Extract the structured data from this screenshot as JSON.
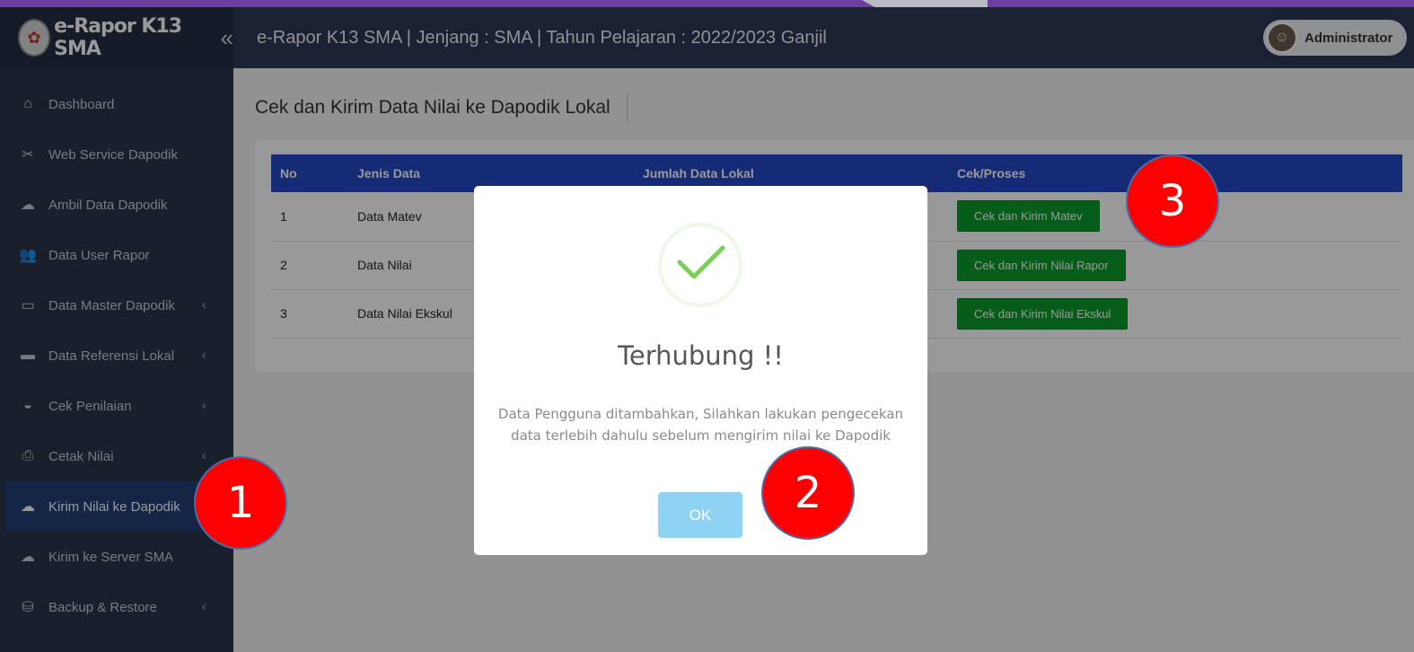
{
  "app": {
    "brand": "e-Rapor K13 SMA",
    "header_title": "e-Rapor K13 SMA | Jenjang : SMA | Tahun Pelajaran : 2022/2023 Ganjil",
    "user_name": "Administrator"
  },
  "sidebar": {
    "collapse_icon": "double-chevron-left-icon",
    "items": [
      {
        "label": "Dashboard",
        "icon": "home-icon",
        "has_caret": false
      },
      {
        "label": "Web Service Dapodik",
        "icon": "tools-icon",
        "has_caret": false
      },
      {
        "label": "Ambil Data Dapodik",
        "icon": "cloud-download-icon",
        "has_caret": false
      },
      {
        "label": "Data User Rapor",
        "icon": "users-icon",
        "has_caret": false
      },
      {
        "label": "Data Master Dapodik",
        "icon": "inbox-icon",
        "has_caret": true
      },
      {
        "label": "Data Referensi Lokal",
        "icon": "inbox-filled-icon",
        "has_caret": true
      },
      {
        "label": "Cek Penilaian",
        "icon": "hdd-icon",
        "has_caret": true
      },
      {
        "label": "Cetak Nilai",
        "icon": "print-icon",
        "has_caret": true
      },
      {
        "label": "Kirim Nilai ke Dapodik",
        "icon": "cloud-upload-icon",
        "has_caret": false,
        "active": true
      },
      {
        "label": "Kirim ke Server SMA",
        "icon": "cloud-upload-icon",
        "has_caret": false
      },
      {
        "label": "Backup & Restore",
        "icon": "database-icon",
        "has_caret": true
      }
    ]
  },
  "page": {
    "title": "Cek dan Kirim Data Nilai ke Dapodik Lokal"
  },
  "table": {
    "headers": [
      "No",
      "Jenis Data",
      "Jumlah Data Lokal",
      "Cek/Proses"
    ],
    "rows": [
      {
        "no": "1",
        "jenis": "Data Matev",
        "jumlah": "",
        "button": "Cek dan Kirim Matev"
      },
      {
        "no": "2",
        "jenis": "Data Nilai",
        "jumlah": "",
        "button": "Cek dan Kirim Nilai Rapor"
      },
      {
        "no": "3",
        "jenis": "Data Nilai Ekskul",
        "jumlah": "",
        "button": "Cek dan Kirim Nilai Ekskul"
      }
    ]
  },
  "modal": {
    "icon": "success-check-icon",
    "title": "Terhubung !!",
    "message": "Data Pengguna ditambahkan, Silahkan lakukan pengecekan data terlebih dahulu sebelum mengirim nilai ke Dapodik",
    "ok_label": "OK"
  },
  "markers": [
    "1",
    "2",
    "3"
  ],
  "colors": {
    "sidebar_bg": "#2a3648",
    "header_bg": "#2c3754",
    "table_header": "#2348c5",
    "button_green": "#0a9a2a",
    "ok_button": "#8ed3f4",
    "marker_red": "#ff0000",
    "success_check": "#7ccf5a"
  }
}
